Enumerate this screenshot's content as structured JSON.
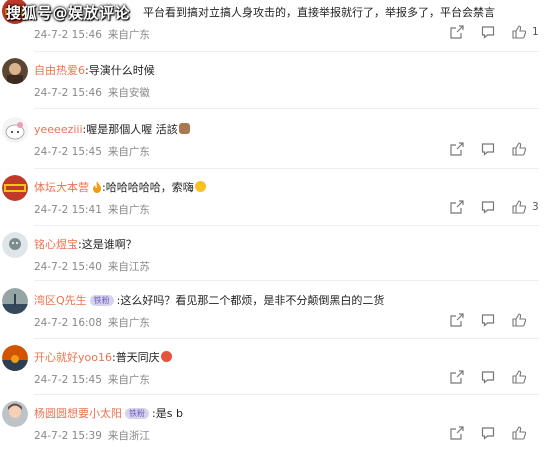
{
  "watermark": "搜狐号@娱放评论",
  "comments": [
    {
      "name": "",
      "text": "平台看到搞对立搞人身攻击的，直接举报就行了，举报多了，平台会禁言",
      "date": "24-7-2 15:46",
      "location": "来自广东",
      "likes": "1",
      "avatar_colors": [
        "#c0392b",
        "#f39c12"
      ]
    },
    {
      "name": "自由热爱6",
      "text": "导演什么时候",
      "date": "24-7-2 15:46",
      "location": "来自安徽",
      "likes": "",
      "avatar_colors": [
        "#5a4632",
        "#d9b38c"
      ]
    },
    {
      "name": "yeeeeziii",
      "text": "喔是那個人喔 活該",
      "date": "24-7-2 15:45",
      "location": "来自广东",
      "likes": "",
      "avatar_colors": [
        "#f4f4f4",
        "#e8a0b4"
      ]
    },
    {
      "name": "体坛大本营",
      "text": "哈哈哈哈哈，索嗨",
      "date": "24-7-2 15:41",
      "location": "来自广东",
      "likes": "3",
      "avatar_colors": [
        "#c0392b",
        "#f1c40f"
      ]
    },
    {
      "name": "铭心煜宝",
      "text": "这是谁啊？",
      "date": "24-7-2 15:40",
      "location": "来自江苏",
      "likes": "",
      "avatar_colors": [
        "#7f8c8d",
        "#dfe6e9"
      ]
    },
    {
      "name": "湾区Q先生",
      "badge": "铁粉",
      "text": "这么好吗？看见那二个都烦，是非不分颠倒黑白的二货",
      "date": "24-7-2 16:08",
      "location": "来自广东",
      "likes": "",
      "avatar_colors": [
        "#34495e",
        "#95a5a6"
      ]
    },
    {
      "name": "开心就好yoo16",
      "text": "普天同庆",
      "date": "24-7-2 15:45",
      "location": "来自广东",
      "likes": "",
      "avatar_colors": [
        "#d35400",
        "#2c3e50"
      ]
    },
    {
      "name": "杨圆圆想要小太阳",
      "badge": "铁粉",
      "text": "是s b",
      "date": "24-7-2 15:39",
      "location": "来自浙江",
      "likes": "",
      "avatar_colors": [
        "#bdc3c7",
        "#6d4c41"
      ]
    }
  ]
}
